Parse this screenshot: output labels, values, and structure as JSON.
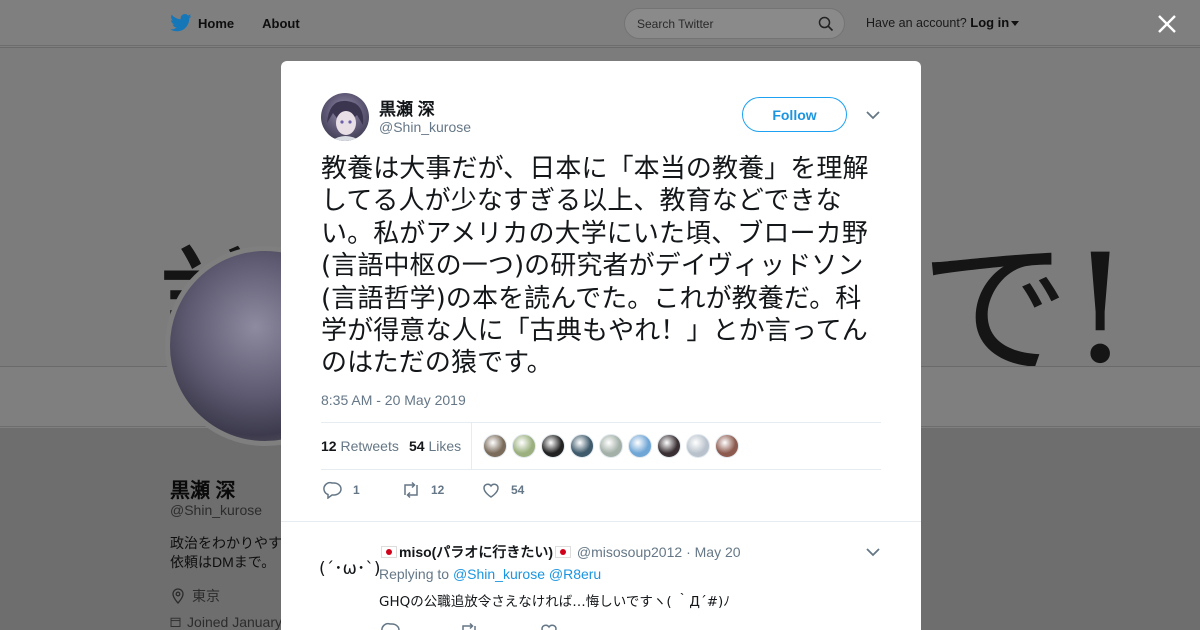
{
  "nav": {
    "home_label": "Home",
    "about_label": "About",
    "search_placeholder": "Search Twitter",
    "have_account": "Have an account?",
    "login_label": "Log in"
  },
  "profile_bg": {
    "name": "黒瀬 深",
    "handle": "@Shin_kurose",
    "bio_line1": "政治をわかりやすく",
    "bio_line2": "依頼はDMまで。",
    "location": "東京",
    "joined": "Joined January"
  },
  "tweet": {
    "author_name": "黒瀬 深",
    "author_handle": "@Shin_kurose",
    "follow_label": "Follow",
    "text": "教養は大事だが、日本に「本当の教養」を理解してる人が少なすぎる以上、教育などできない。私がアメリカの大学にいた頃、ブローカ野(言語中枢の一つ)の研究者がデイヴィッドソン(言語哲学)の本を読んでた。これが教養だ。科学が得意な人に「古典もやれ！」とか言ってんのはただの猿です。",
    "timestamp": "8:35 AM - 20 May 2019",
    "retweets_count": "12",
    "retweets_label": "Retweets",
    "likes_count": "54",
    "likes_label": "Likes",
    "reply_count": "1",
    "retweet_action_count": "12",
    "like_action_count": "54",
    "liker_colors": [
      "#7a6b5a",
      "#9bb07e",
      "#222222",
      "#3e5a6b",
      "#a3b0a8",
      "#6fa6d6",
      "#3a3034",
      "#b9c2cc",
      "#8c5a4e"
    ]
  },
  "reply": {
    "avatar_text": "(´･ω･`)",
    "name": "miso(パラオに行きたい)",
    "handle": "@misosoup2012",
    "date": "· May 20",
    "replying_prefix": "Replying to",
    "replying_to_1": "@Shin_kurose",
    "replying_to_2": "@R8eru",
    "text": "GHQの公職追放令さえなければ…悔しいですヽ( ｀Д´#)ﾉ"
  },
  "colors": {
    "twitter_blue": "#1da1f2",
    "link_blue": "#1b95e0",
    "secondary_text": "#657786"
  }
}
